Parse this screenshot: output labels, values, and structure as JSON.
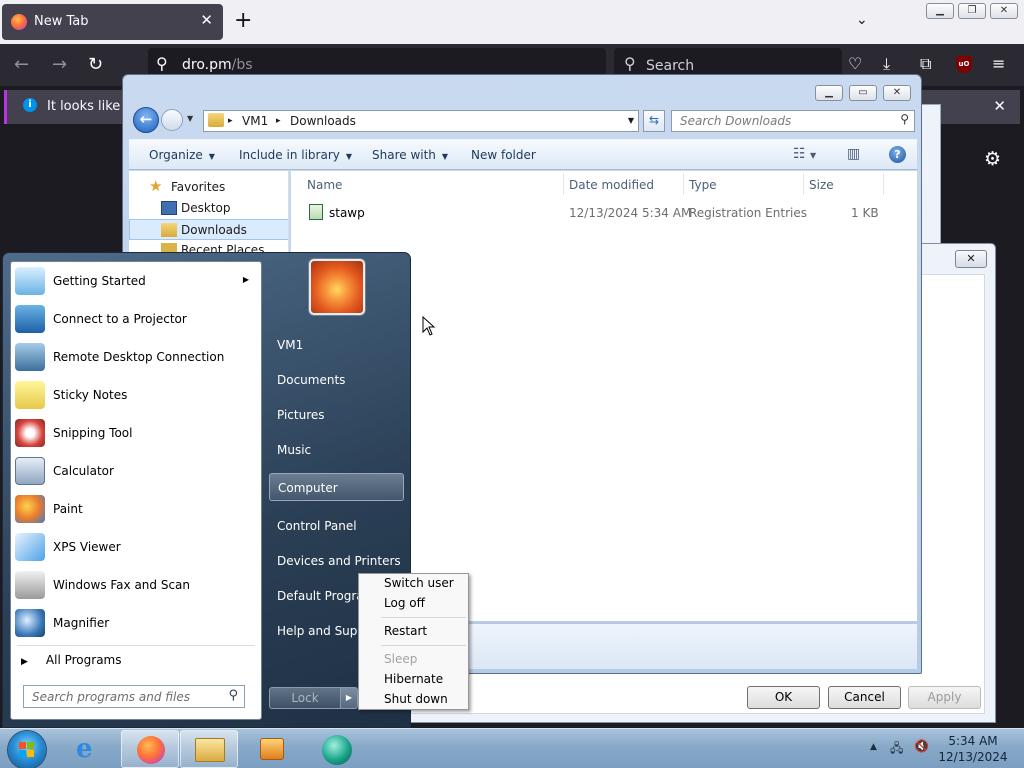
{
  "browser": {
    "tab_title": "New Tab",
    "url": "dro.pm",
    "url_path": "/bs",
    "search_placeholder": "Search",
    "notification": "It looks like you"
  },
  "explorer": {
    "path": [
      "VM1",
      "Downloads"
    ],
    "search_placeholder": "Search Downloads",
    "commands": {
      "organize": "Organize",
      "include": "Include in library",
      "share": "Share with",
      "new_folder": "New folder"
    },
    "nav": {
      "favorites": "Favorites",
      "desktop": "Desktop",
      "downloads": "Downloads",
      "recent": "Recent Places"
    },
    "columns": {
      "name": "Name",
      "date": "Date modified",
      "type": "Type",
      "size": "Size"
    },
    "files": [
      {
        "name": "stawp",
        "date": "12/13/2024 5:34 AM",
        "type": "Registration Entries",
        "size": "1 KB"
      }
    ]
  },
  "dialog": {
    "close": "✕",
    "ok": "OK",
    "cancel": "Cancel",
    "apply": "Apply"
  },
  "start_menu": {
    "programs": [
      {
        "label": "Getting Started",
        "icon": "getting-started-icon"
      },
      {
        "label": "Connect to a Projector",
        "icon": "projector-icon"
      },
      {
        "label": "Remote Desktop Connection",
        "icon": "remote-desktop-icon"
      },
      {
        "label": "Sticky Notes",
        "icon": "sticky-notes-icon"
      },
      {
        "label": "Snipping Tool",
        "icon": "snipping-tool-icon"
      },
      {
        "label": "Calculator",
        "icon": "calculator-icon"
      },
      {
        "label": "Paint",
        "icon": "paint-icon"
      },
      {
        "label": "XPS Viewer",
        "icon": "xps-viewer-icon"
      },
      {
        "label": "Windows Fax and Scan",
        "icon": "fax-scan-icon"
      },
      {
        "label": "Magnifier",
        "icon": "magnifier-icon"
      }
    ],
    "all_programs": "All Programs",
    "search_placeholder": "Search programs and files",
    "right": {
      "user": "VM1",
      "documents": "Documents",
      "pictures": "Pictures",
      "music": "Music",
      "computer": "Computer",
      "control_panel": "Control Panel",
      "devices": "Devices and Printers",
      "default_programs": "Default Programs",
      "help": "Help and Support"
    },
    "lock": "Lock"
  },
  "power_menu": {
    "switch_user": "Switch user",
    "log_off": "Log off",
    "restart": "Restart",
    "sleep": "Sleep",
    "hibernate": "Hibernate",
    "shut_down": "Shut down"
  },
  "taskbar": {
    "time": "5:34 AM",
    "date": "12/13/2024"
  }
}
